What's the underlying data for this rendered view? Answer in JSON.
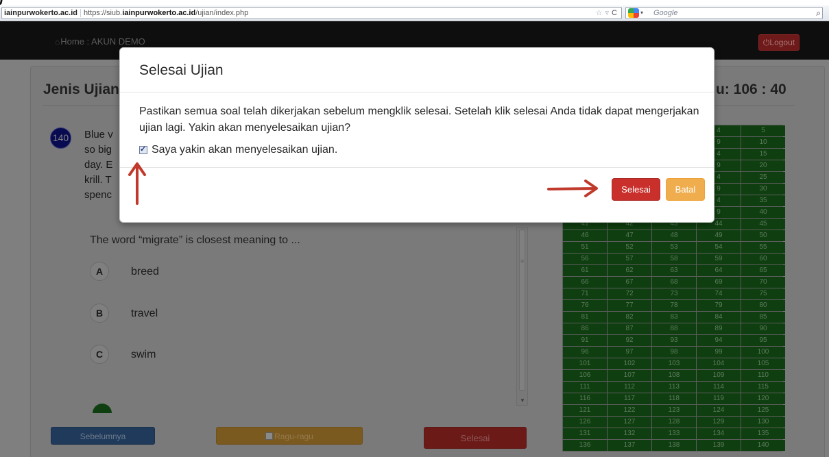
{
  "top_cropped_text": "j",
  "browser": {
    "site": "iainpurwokerto.ac.id",
    "url_prefix": "https://siub.",
    "url_domain": "iainpurwokerto.ac.id",
    "url_path": "/ujian/index.php",
    "star_icon": "star-icon",
    "reload_icon": "reload-icon",
    "search_placeholder": "Google",
    "search_icon": "search-icon"
  },
  "navbar": {
    "home_label": "Home : AKUN DEMO",
    "logout_label": "Logout"
  },
  "panel": {
    "exam_title_visible": "Jenis Ujian",
    "timer_visible": "u: 106 : 40"
  },
  "question": {
    "number": "140",
    "text_lines_visible": [
      "Blue v",
      "so big",
      "day. E",
      "krill. T",
      "spenc"
    ],
    "prompt": "The word “migrate” is closest meaning to ...",
    "options": [
      {
        "letter": "A",
        "text": "breed"
      },
      {
        "letter": "B",
        "text": "travel"
      },
      {
        "letter": "C",
        "text": "swim"
      }
    ]
  },
  "nav_buttons": {
    "prev": "Sebelumnya",
    "doubt": "Ragu-ragu",
    "finish": "Selesai"
  },
  "question_numbers": {
    "partial_first_rows": [
      "4",
      "5",
      "9",
      "10",
      "4",
      "15",
      "9",
      "20",
      "4",
      "25",
      "9",
      "30",
      "4",
      "35",
      "9",
      "40"
    ],
    "full_rows": [
      [
        "41",
        "42",
        "43",
        "44",
        "45"
      ],
      [
        "46",
        "47",
        "48",
        "49",
        "50"
      ],
      [
        "51",
        "52",
        "53",
        "54",
        "55"
      ],
      [
        "56",
        "57",
        "58",
        "59",
        "60"
      ],
      [
        "61",
        "62",
        "63",
        "64",
        "65"
      ],
      [
        "66",
        "67",
        "68",
        "69",
        "70"
      ],
      [
        "71",
        "72",
        "73",
        "74",
        "75"
      ],
      [
        "76",
        "77",
        "78",
        "79",
        "80"
      ],
      [
        "81",
        "82",
        "83",
        "84",
        "85"
      ],
      [
        "86",
        "87",
        "88",
        "89",
        "90"
      ],
      [
        "91",
        "92",
        "93",
        "94",
        "95"
      ],
      [
        "96",
        "97",
        "98",
        "99",
        "100"
      ],
      [
        "101",
        "102",
        "103",
        "104",
        "105"
      ],
      [
        "106",
        "107",
        "108",
        "109",
        "110"
      ],
      [
        "111",
        "112",
        "113",
        "114",
        "115"
      ],
      [
        "116",
        "117",
        "118",
        "119",
        "120"
      ],
      [
        "121",
        "122",
        "123",
        "124",
        "125"
      ],
      [
        "126",
        "127",
        "128",
        "129",
        "130"
      ],
      [
        "131",
        "132",
        "133",
        "134",
        "135"
      ],
      [
        "136",
        "137",
        "138",
        "139",
        "140"
      ]
    ]
  },
  "modal": {
    "title": "Selesai Ujian",
    "message": "Pastikan semua soal telah dikerjakan sebelum mengklik selesai. Setelah klik selesai Anda tidak dapat mengerjakan ujian lagi. Yakin akan menyelesaikan ujian?",
    "confirm_label": "Saya yakin akan menyelesaikan ujian.",
    "confirm_checked": true,
    "finish_button": "Selesai",
    "cancel_button": "Batal"
  },
  "colors": {
    "finish_red": "#c9302c",
    "cancel_orange": "#f0ad4e",
    "arrow_red": "#c0392b",
    "grid_green": "#0f3f10"
  }
}
